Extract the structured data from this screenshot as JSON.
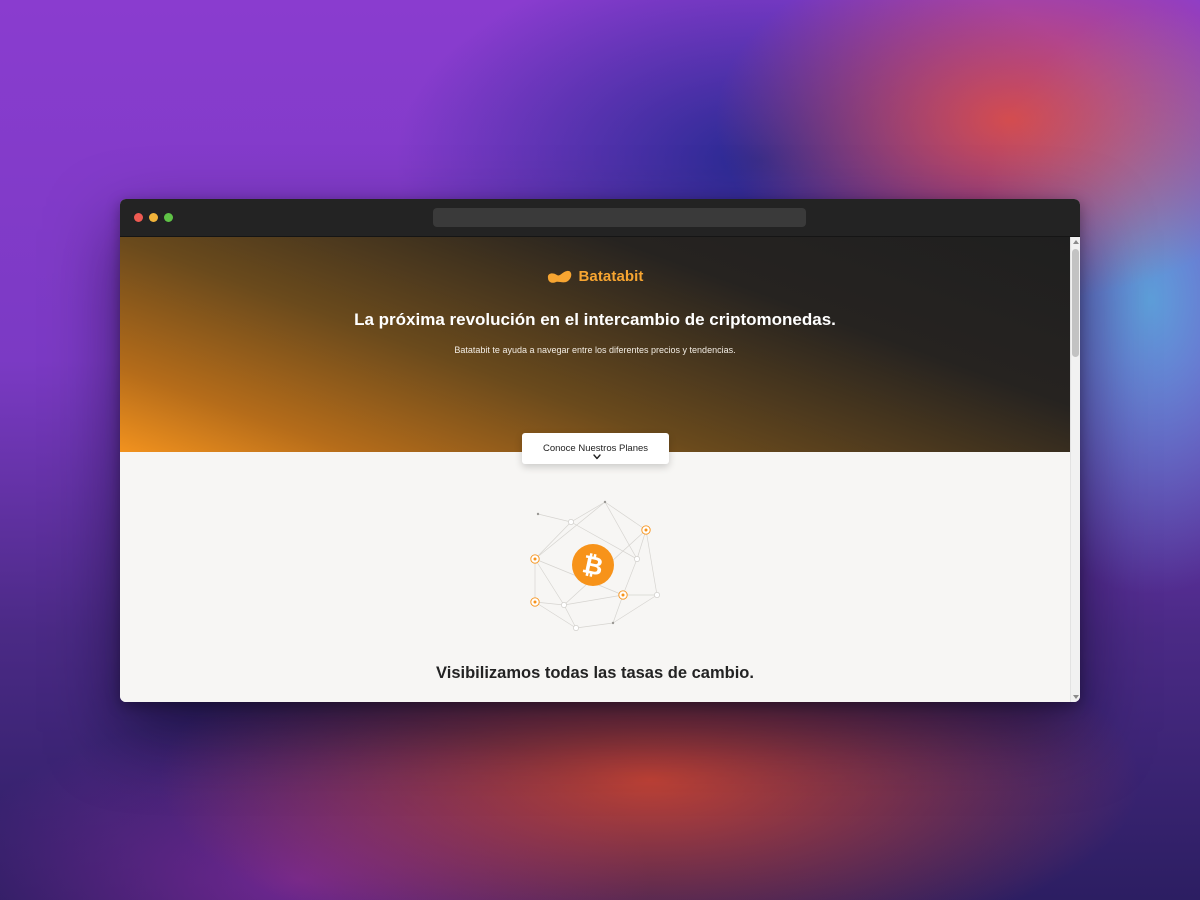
{
  "window": {
    "controls": [
      "close",
      "minimize",
      "maximize"
    ],
    "url": ""
  },
  "hero": {
    "brand_name": "Batatabit",
    "brand_icon": "potato-logo-icon",
    "title": "La próxima revolución en el intercambio de criptomonedas.",
    "subtitle": "Batatabit te ayuda a navegar entre los diferentes precios y tendencias.",
    "cta_label": "Conoce Nuestros Planes",
    "cta_icon": "chevron-down-icon"
  },
  "illustration": {
    "icon": "bitcoin-network-icon",
    "center_glyph": "bitcoin-icon"
  },
  "section": {
    "title": "Visibilizamos todas las tasas de cambio."
  },
  "colors": {
    "accent": "#f7931a",
    "brand_text": "#f7a531",
    "hero_dark": "#1f1f1f",
    "page_bg": "#f7f6f4"
  }
}
